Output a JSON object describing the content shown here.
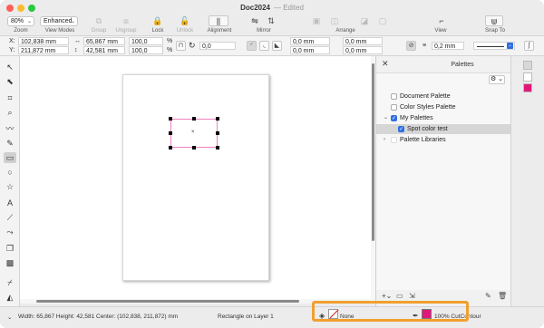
{
  "window": {
    "title": "Doc2024",
    "edited": "— Edited",
    "traffic_colors": [
      "#ff5f57",
      "#febc2e",
      "#28c840"
    ]
  },
  "toolbar": {
    "zoom_value": "80%",
    "view_mode_value": "Enhanced",
    "labels": {
      "zoom": "Zoom",
      "view_modes": "View Modes",
      "group": "Group",
      "ungroup": "Ungroup",
      "lock": "Lock",
      "unlock": "Unlock",
      "alignment": "Alignment",
      "mirror": "Mirror",
      "arrange": "Arrange",
      "view": "View",
      "snap_to": "Snap To"
    }
  },
  "propbar": {
    "x": "102,838 mm",
    "y": "211,872 mm",
    "width": "65,867 mm",
    "height": "42,581 mm",
    "scale_x": "100,0",
    "scale_y": "100,0",
    "percent": "%",
    "rotation": "0,0",
    "corner_1": "0,0 mm",
    "corner_2": "0,0 mm",
    "corner_3": "0,0 mm",
    "corner_4": "0,0 mm",
    "outline_width": "0,2 mm",
    "x_label": "X:",
    "y_label": "Y:"
  },
  "dock": {
    "title": "Palettes",
    "items": [
      {
        "label": "Document Palette",
        "checked": false
      },
      {
        "label": "Color Styles Palette",
        "checked": false
      },
      {
        "label": "My Palettes",
        "checked": true
      },
      {
        "label": "Spot color test",
        "checked": true
      },
      {
        "label": "Palette Libraries",
        "checked": false
      }
    ],
    "swatch_color": "#e0187c"
  },
  "status": {
    "dimensions": "Width: 65,867  Height: 42,581  Center: (102,838, 211,872)  mm",
    "object": "Rectangle on Layer 1",
    "fill_label": "None",
    "outline_label": "100% CutContour",
    "outline_color": "#e0187c",
    "highlight_color": "#f0a030"
  }
}
